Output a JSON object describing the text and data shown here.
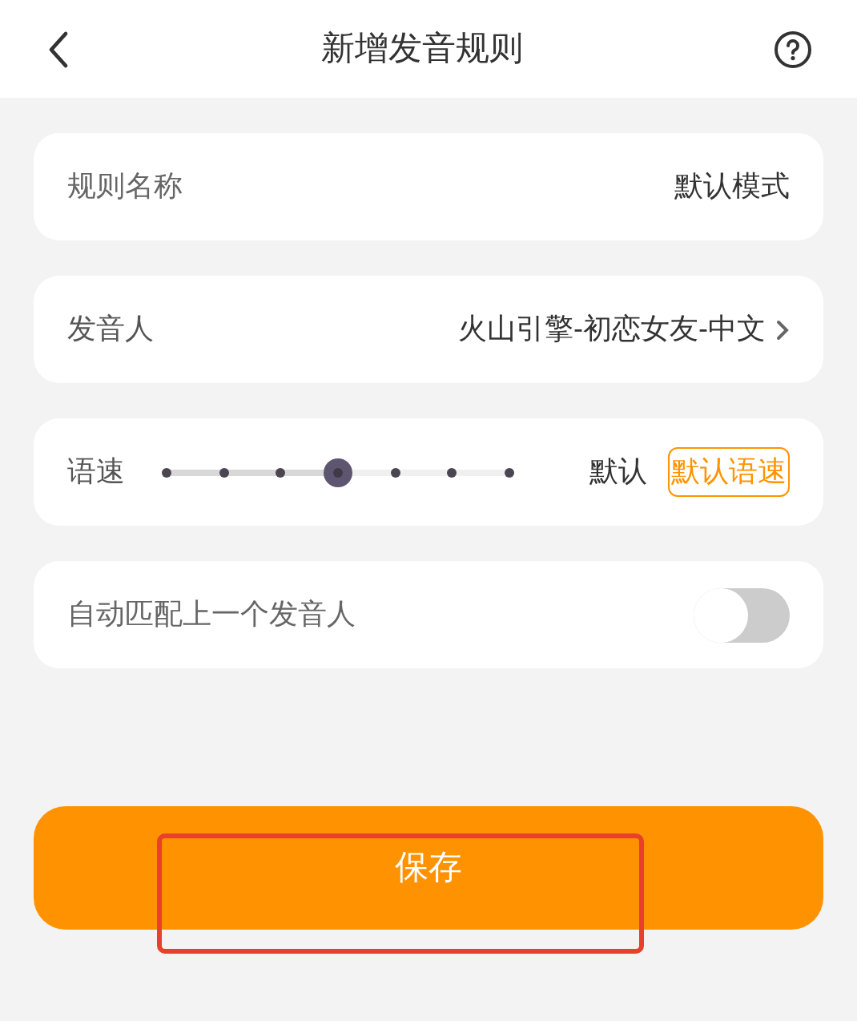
{
  "header": {
    "title": "新增发音规则"
  },
  "rule_name": {
    "label": "规则名称",
    "value": "默认模式"
  },
  "speaker": {
    "label": "发音人",
    "value": "火山引擎-初恋女友-中文"
  },
  "speed": {
    "label": "语速",
    "level": 0.5,
    "reading": "默认",
    "button": "默认语速"
  },
  "auto_match": {
    "label": "自动匹配上一个发音人",
    "on": false
  },
  "save_button": {
    "label": "保存"
  },
  "highlight": {
    "color": "#e8402a"
  }
}
